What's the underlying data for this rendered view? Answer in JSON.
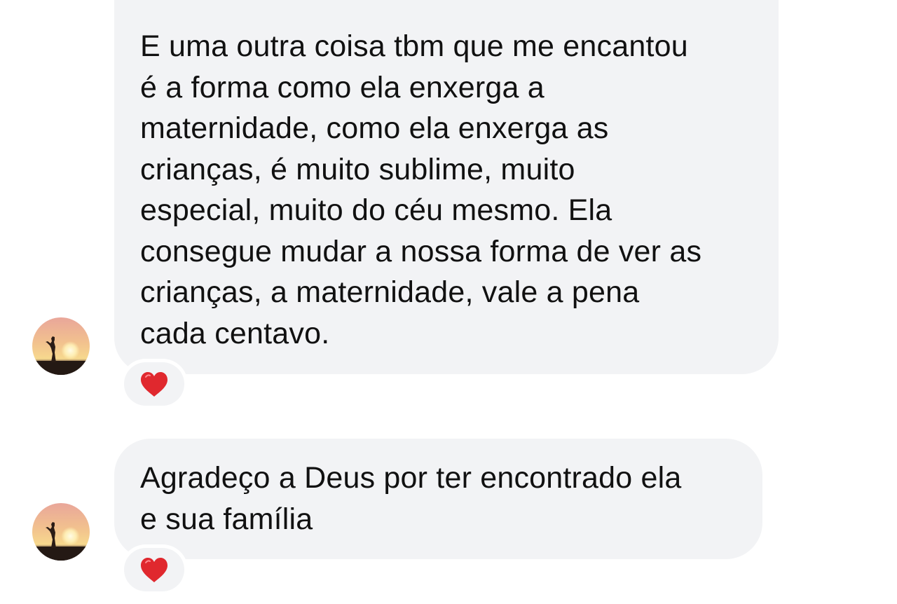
{
  "messages": [
    {
      "lines": [
        "E uma outra coisa tbm que me encantou",
        "é a forma como ela enxerga a",
        "maternidade, como ela enxerga as",
        "crianças, é muito sublime, muito",
        "especial, muito do céu mesmo. Ela",
        "consegue mudar a nossa forma de ver as",
        "crianças, a maternidade, vale a pena",
        "cada centavo."
      ],
      "reaction_icon": "red-heart-icon",
      "avatar_icon": "sunset-silhouette-avatar"
    },
    {
      "lines": [
        "Agradeço a Deus por ter encontrado ela",
        "e sua família"
      ],
      "reaction_icon": "red-heart-icon",
      "avatar_icon": "sunset-silhouette-avatar"
    }
  ],
  "colors": {
    "bubble_background": "#f2f3f5",
    "text": "#111111",
    "heart": "#e0282e"
  }
}
